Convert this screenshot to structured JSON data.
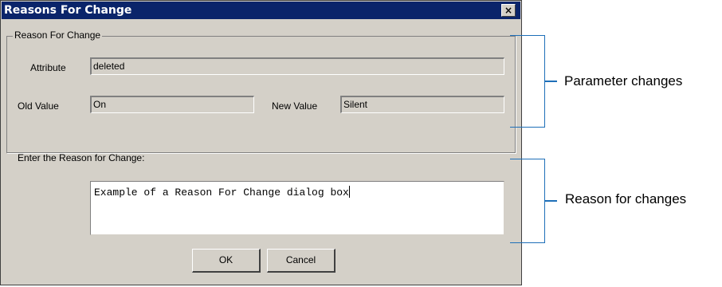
{
  "dialog": {
    "title": "Reasons For Change",
    "close_glyph": "×",
    "group_label": "Reason For Change",
    "attribute": {
      "label": "Attribute",
      "value": "deleted"
    },
    "old_value": {
      "label": "Old Value",
      "value": "On"
    },
    "new_value": {
      "label": "New Value",
      "value": "Silent"
    },
    "reason_prompt": "Enter the Reason for Change:",
    "reason_text": "Example of a Reason For Change dialog box",
    "ok_label": "OK",
    "cancel_label": "Cancel"
  },
  "annotations": {
    "parameter_changes": "Parameter changes",
    "reason_for_changes": "Reason for changes"
  },
  "colors": {
    "titlebar": "#0a246a",
    "dialog_face": "#d4d0c8",
    "annotation_bracket": "#1e6fb8"
  }
}
